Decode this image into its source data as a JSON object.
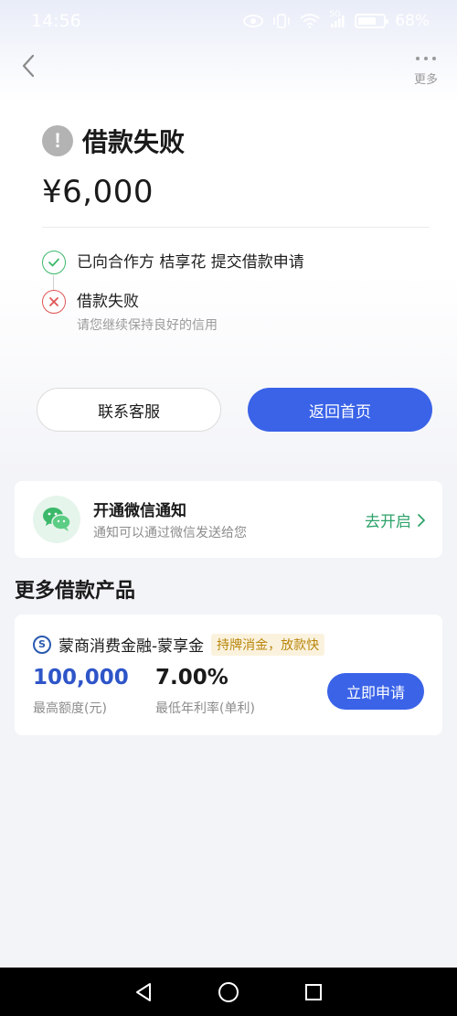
{
  "status_bar": {
    "time": "14:56",
    "network": "5G",
    "battery": "68%",
    "battery_level": 0.68
  },
  "nav": {
    "more_label": "更多"
  },
  "result": {
    "title": "借款失败",
    "amount": "¥6,000",
    "steps": [
      {
        "text": "已向合作方 桔享花 提交借款申请",
        "status": "success"
      },
      {
        "text": "借款失败",
        "subtext": "请您继续保持良好的信用",
        "status": "failed"
      }
    ]
  },
  "actions": {
    "contact_label": "联系客服",
    "home_label": "返回首页"
  },
  "wechat": {
    "title": "开通微信通知",
    "subtitle": "通知可以通过微信发送给您",
    "action_label": "去开启"
  },
  "more_products": {
    "section_title": "更多借款产品",
    "items": [
      {
        "name": "蒙商消费金融-蒙享金",
        "tag": "持牌消金，放款快",
        "amount": "100,000",
        "amount_label": "最高额度(元)",
        "rate": "7.00%",
        "rate_label": "最低年利率(单利)",
        "apply_label": "立即申请"
      }
    ]
  },
  "colors": {
    "primary": "#3a63e8",
    "success": "#3bb86a",
    "error": "#e05555",
    "wechat_green": "#2ea36a",
    "tag_text": "#b8860b"
  }
}
